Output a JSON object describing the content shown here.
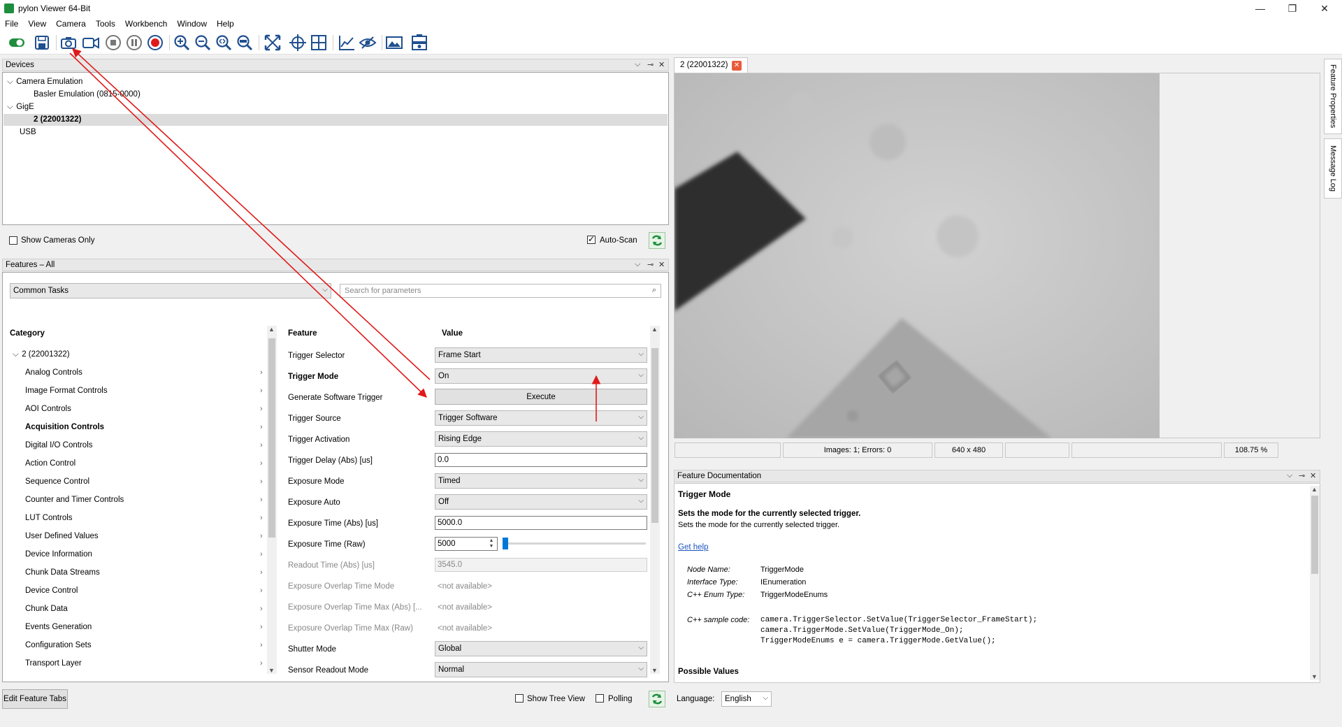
{
  "window": {
    "title": "pylon Viewer 64-Bit",
    "minimize": "—",
    "restore": "❐",
    "close": "✕"
  },
  "menu": [
    "File",
    "View",
    "Camera",
    "Tools",
    "Workbench",
    "Window",
    "Help"
  ],
  "toolbar_icons": [
    "connect-toggle-icon",
    "save-icon",
    "single-shot-camera-icon",
    "continuous-video-icon",
    "stop-icon",
    "pause-icon",
    "record-icon",
    "zoom-in-icon",
    "zoom-out-icon",
    "zoom-fit-icon",
    "zoom-100-icon",
    "fit-window-icon",
    "center-crosshair-icon",
    "grid-overlay-icon",
    "histogram-icon",
    "pixel-inspector-icon",
    "image-display-icon",
    "stacked-camera-icon"
  ],
  "devices_panel": {
    "title": "Devices",
    "tree": [
      {
        "label": "Camera Emulation",
        "level": 0,
        "expanded": true
      },
      {
        "label": "Basler Emulation (0815-0000)",
        "level": 1
      },
      {
        "label": "GigE",
        "level": 0,
        "expanded": true
      },
      {
        "label": "2 (22001322)",
        "level": 1,
        "selected": true
      },
      {
        "label": "USB",
        "level": 0
      }
    ],
    "show_cameras_only": "Show Cameras Only",
    "auto_scan": "Auto-Scan"
  },
  "features_panel": {
    "title": "Features – All",
    "task_combo": "Common Tasks",
    "search_placeholder": "Search for parameters",
    "category_header": "Category",
    "feature_header": "Feature",
    "value_header": "Value",
    "root": "2 (22001322)",
    "categories": [
      "Analog Controls",
      "Image Format Controls",
      "AOI Controls",
      "Acquisition Controls",
      "Digital I/O Controls",
      "Action Control",
      "Sequence Control",
      "Counter and Timer Controls",
      "LUT Controls",
      "User Defined Values",
      "Device Information",
      "Chunk Data Streams",
      "Device Control",
      "Chunk Data",
      "Events Generation",
      "Configuration Sets",
      "Transport Layer"
    ],
    "features": [
      {
        "name": "Trigger Selector",
        "kind": "combo",
        "value": "Frame Start"
      },
      {
        "name": "Trigger Mode",
        "kind": "combo",
        "value": "On",
        "bold": true
      },
      {
        "name": "Generate Software Trigger",
        "kind": "button",
        "value": "Execute"
      },
      {
        "name": "Trigger Source",
        "kind": "combo",
        "value": "Trigger Software"
      },
      {
        "name": "Trigger Activation",
        "kind": "combo",
        "value": "Rising Edge"
      },
      {
        "name": "Trigger Delay (Abs) [us]",
        "kind": "edit",
        "value": "0.0"
      },
      {
        "name": "Exposure Mode",
        "kind": "combo",
        "value": "Timed"
      },
      {
        "name": "Exposure Auto",
        "kind": "combo",
        "value": "Off"
      },
      {
        "name": "Exposure Time (Abs) [us]",
        "kind": "edit",
        "value": "5000.0"
      },
      {
        "name": "Exposure Time (Raw)",
        "kind": "spin",
        "value": "5000"
      },
      {
        "name": "Readout Time (Abs) [us]",
        "kind": "disabled",
        "value": "3545.0"
      },
      {
        "name": "Exposure Overlap Time Mode",
        "kind": "na",
        "value": "<not available>"
      },
      {
        "name": "Exposure Overlap Time Max (Abs) [...",
        "kind": "na",
        "value": "<not available>"
      },
      {
        "name": "Exposure Overlap Time Max (Raw)",
        "kind": "na",
        "value": "<not available>"
      },
      {
        "name": "Shutter Mode",
        "kind": "combo",
        "value": "Global"
      },
      {
        "name": "Sensor Readout Mode",
        "kind": "combo",
        "value": "Normal"
      }
    ],
    "edit_tabs": "Edit Feature Tabs",
    "show_tree_view": "Show Tree View",
    "polling": "Polling"
  },
  "image_view": {
    "tab": "2 (22001322)",
    "status": [
      "",
      "Images: 1; Errors: 0",
      "640 x 480",
      "",
      "",
      "108.75 %"
    ]
  },
  "doc_panel": {
    "title": "Feature Documentation",
    "heading": "Trigger Mode",
    "summary": "Sets the mode for the currently selected trigger.",
    "summary2": "Sets the mode for the currently selected trigger.",
    "help_link": "Get help",
    "node_name_label": "Node Name:",
    "node_name": "TriggerMode",
    "iface_label": "Interface Type:",
    "iface": "IEnumeration",
    "enum_label": "C++ Enum Type:",
    "enum": "TriggerModeEnums",
    "code_label": "C++ sample code:",
    "code1": "camera.TriggerSelector.SetValue(TriggerSelector_FrameStart);",
    "code2": "camera.TriggerMode.SetValue(TriggerMode_On);",
    "code3": "TriggerModeEnums e = camera.TriggerMode.GetValue();",
    "possible": "Possible Values"
  },
  "language": {
    "label": "Language:",
    "value": "English"
  },
  "side_tabs": [
    "Feature Properties",
    "Message Log"
  ]
}
